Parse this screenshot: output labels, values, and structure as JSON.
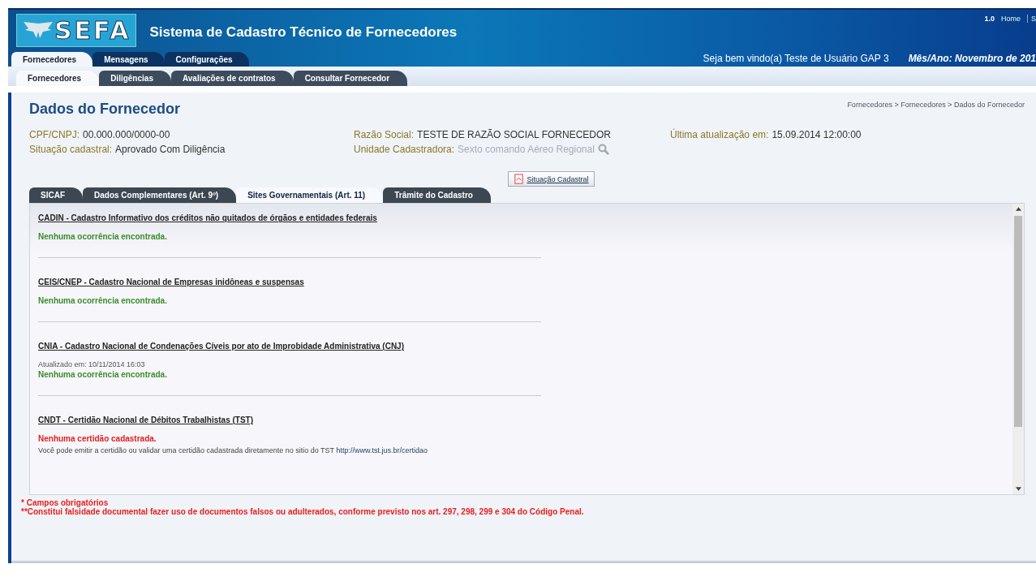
{
  "header": {
    "logo": "SEFA",
    "title": "Sistema de Cadastro Técnico de Fornecedores",
    "version": "1.0",
    "links": [
      "Home",
      "S"
    ],
    "welcome": "Seja bem vindo(a) Teste de Usuário GAP 3",
    "period": "Mês/Ano: Novembro de 201"
  },
  "main_tabs": [
    {
      "label": "Fornecedores",
      "selected": true
    },
    {
      "label": "Mensagens",
      "selected": false
    },
    {
      "label": "Configurações",
      "selected": false
    }
  ],
  "sub_tabs": [
    {
      "label": "Fornecedores",
      "selected": true
    },
    {
      "label": "Diligências",
      "selected": false
    },
    {
      "label": "Avaliações de contratos",
      "selected": false
    },
    {
      "label": "Consultar Fornecedor",
      "selected": false
    }
  ],
  "page": {
    "title": "Dados do Fornecedor",
    "breadcrumb": "Fornecedores > Fornecedores > Dados do Fornecedor"
  },
  "fields": [
    {
      "label": "CPF/CNPJ:",
      "value": "00.000.000/0000-00",
      "kind": "text"
    },
    {
      "label": "Razão Social:",
      "value": "TESTE DE RAZÃO SOCIAL FORNECEDOR",
      "kind": "text"
    },
    {
      "label": "Última atualização em:",
      "value": "15.09.2014 12:00:00",
      "kind": "text"
    },
    {
      "label": "Situação cadastral:",
      "value": "Aprovado Com Diligência",
      "kind": "text"
    },
    {
      "label": "Unidade Cadastradora:",
      "value": "Sexto comando Aéreo Regional",
      "kind": "lookup"
    }
  ],
  "status_button": "Situação Cadastral",
  "detail_tabs": [
    {
      "label": "SICAF",
      "selected": false
    },
    {
      "label": "Dados Complementares (Art. 9º)",
      "selected": false
    },
    {
      "label": "Sites Governamentais (Art. 11)",
      "selected": true
    },
    {
      "label": "Trâmite do Cadastro",
      "selected": false
    }
  ],
  "sections": [
    {
      "title": "CADIN - Cadastro Informativo dos créditos não quitados de órgãos e entidades federais",
      "status": "Nenhuma ocorrência encontrada.",
      "kind": "ok"
    },
    {
      "title": "CEIS/CNEP - Cadastro Nacional de Empresas inidôneas e suspensas",
      "status": "Nenhuma ocorrência encontrada.",
      "kind": "ok"
    },
    {
      "title": "CNIA - Cadastro Nacional de Condenações Cíveis por ato de Improbidade Administrativa (CNJ)",
      "updated": "Atualizado em: 10/11/2014 16:03",
      "status": "Nenhuma ocorrência encontrada.",
      "kind": "ok"
    },
    {
      "title": "CNDT - Certidão Nacional de Débitos Trabalhistas (TST)",
      "status": "Nenhuma certidão cadastrada.",
      "kind": "missing",
      "note": "Você pode emitir a certidão ou validar uma certidão cadastrada diretamente no sitio do TST",
      "link": "http://www.tst.jus.br/certidao"
    }
  ],
  "footnotes": [
    "* Campos obrigatórios",
    "**Constitui falsidade documental fazer uso de documentos falsos ou adulterados, conforme previsto nos art. 297, 298, 299 e 304 do Código Penal."
  ]
}
